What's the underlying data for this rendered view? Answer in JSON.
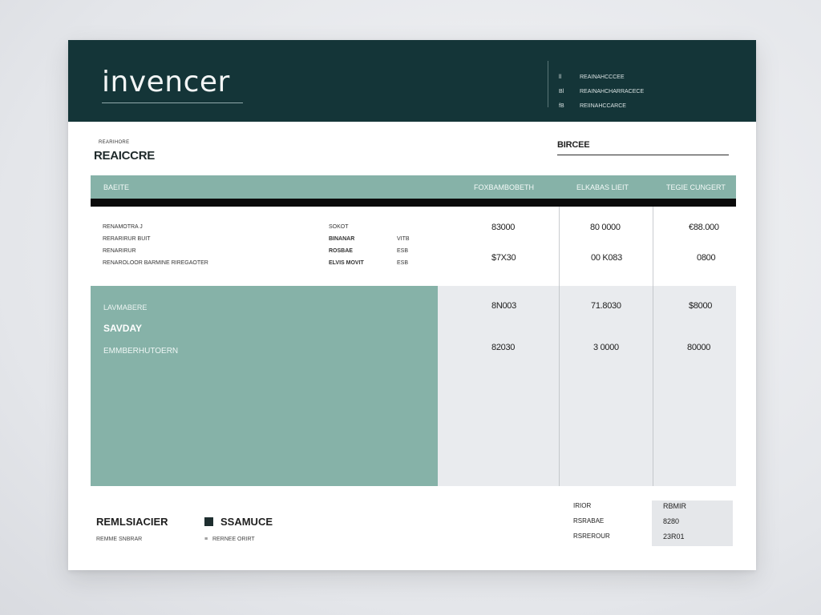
{
  "header": {
    "brand": "invencer",
    "info": [
      {
        "k": "ll",
        "v": "REAINAHCCCEE"
      },
      {
        "k": "Bl",
        "v": "REAINAHCHARRACECE"
      },
      {
        "k": "fB",
        "v": "REIINAHCCARCE"
      }
    ]
  },
  "document": {
    "small_label": "REARIHORE",
    "title": "REAICCRE",
    "field_label": "BIRCEE"
  },
  "table": {
    "columns": [
      "BAEITE",
      "FOXBAMBOBETH",
      "ELKABAS LIEIT",
      "TEGIE CUNGERT"
    ],
    "line_items": [
      {
        "desc": "RENAMOTRA J",
        "code": "SOKOT",
        "qty": ""
      },
      {
        "desc": "RERARIRUR BUIT",
        "code": "BINANAR",
        "qty": "VITB"
      },
      {
        "desc": "RENARIRUR",
        "code": "ROSBAE",
        "qty": "ESB"
      },
      {
        "desc": "RENAROLOOR BARMINE RIREGAOTER",
        "code": "ELVIS MOVIT",
        "qty": "ESB"
      }
    ],
    "row_values": [
      {
        "a": "83000",
        "b": "80 0000",
        "c": "€88.000"
      },
      {
        "a": "$7X30",
        "b": "00 K083",
        "c": "0800"
      }
    ]
  },
  "summary": {
    "label": "LAVMABERE",
    "title": "SAVDAY",
    "note": "EMMBERHUTOERN",
    "values": [
      {
        "a": "8N003",
        "b": "71.8030",
        "c": "$8000"
      },
      {
        "a": "82030",
        "b": "3 0000",
        "c": "80000"
      }
    ]
  },
  "footer": {
    "left_title": "REMLSIACIER",
    "left_sub": "REMME SNBRAR",
    "mid_title": "SSAMUCE",
    "mid_sub": "RERNEE ORIRT",
    "totals": [
      {
        "label": "IRIOR",
        "value": "RBMIR"
      },
      {
        "label": "RSRABAE",
        "value": "8280"
      },
      {
        "label": "RSREROUR",
        "value": "23R01"
      }
    ]
  }
}
